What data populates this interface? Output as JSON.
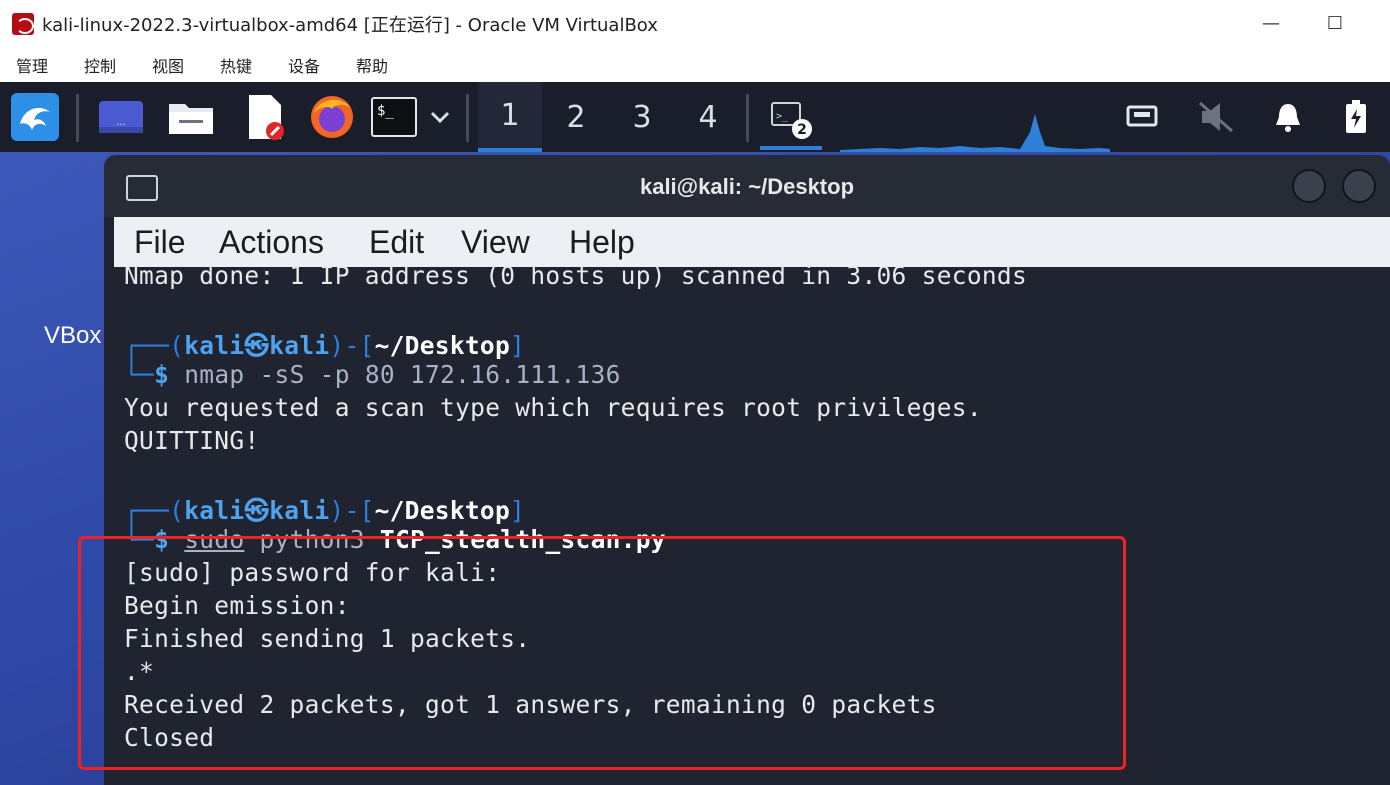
{
  "window": {
    "title": "kali-linux-2022.3-virtualbox-amd64 [正在运行] - Oracle VM VirtualBox",
    "minimize_glyph": "—",
    "maximize_glyph": "☐"
  },
  "vbox_menu": [
    "管理",
    "控制",
    "视图",
    "热键",
    "设备",
    "帮助"
  ],
  "panel": {
    "workspaces": [
      "1",
      "2",
      "3",
      "4"
    ],
    "active_workspace": "1",
    "terminal_badge": "2",
    "icons": [
      "kali-dragon-icon",
      "show-desktop-icon",
      "file-manager-icon",
      "text-editor-icon",
      "firefox-icon",
      "terminal-icon",
      "chevron-down-icon",
      "terminal-task-icon",
      "network-icon",
      "volume-muted-icon",
      "notification-bell-icon",
      "battery-icon"
    ]
  },
  "desktop": {
    "label": "VBox"
  },
  "terminal": {
    "title": "kali@kali: ~/Desktop",
    "menu": [
      "File",
      "Actions",
      "Edit",
      "View",
      "Help"
    ],
    "lines": {
      "nmap_done": "Nmap done: 1 IP address (0 hosts up) scanned in 3.06 seconds",
      "prompt1_user": "kali",
      "prompt1_host": "kali",
      "prompt1_dir": "~/Desktop",
      "cmd1": "nmap -sS -p 80 172.16.111.136",
      "out1a": "You requested a scan type which requires root privileges.",
      "out1b": "QUITTING!",
      "prompt2_user": "kali",
      "prompt2_host": "kali",
      "prompt2_dir": "~/Desktop",
      "cmd2_sudo": "sudo",
      "cmd2_python": "python3",
      "cmd2_script": "TCP_stealth_scan.py",
      "out2a": "[sudo] password for kali:",
      "out2b": "Begin emission:",
      "out2c": "Finished sending 1 packets.",
      "out2d": ".*",
      "out2e": "Received 2 packets, got 1 answers, remaining 0 packets",
      "out2f": "Closed"
    }
  },
  "colors": {
    "highlight": "#ee2222",
    "prompt_blue": "#2f7fe0",
    "terminal_bg": "#1f2430"
  }
}
